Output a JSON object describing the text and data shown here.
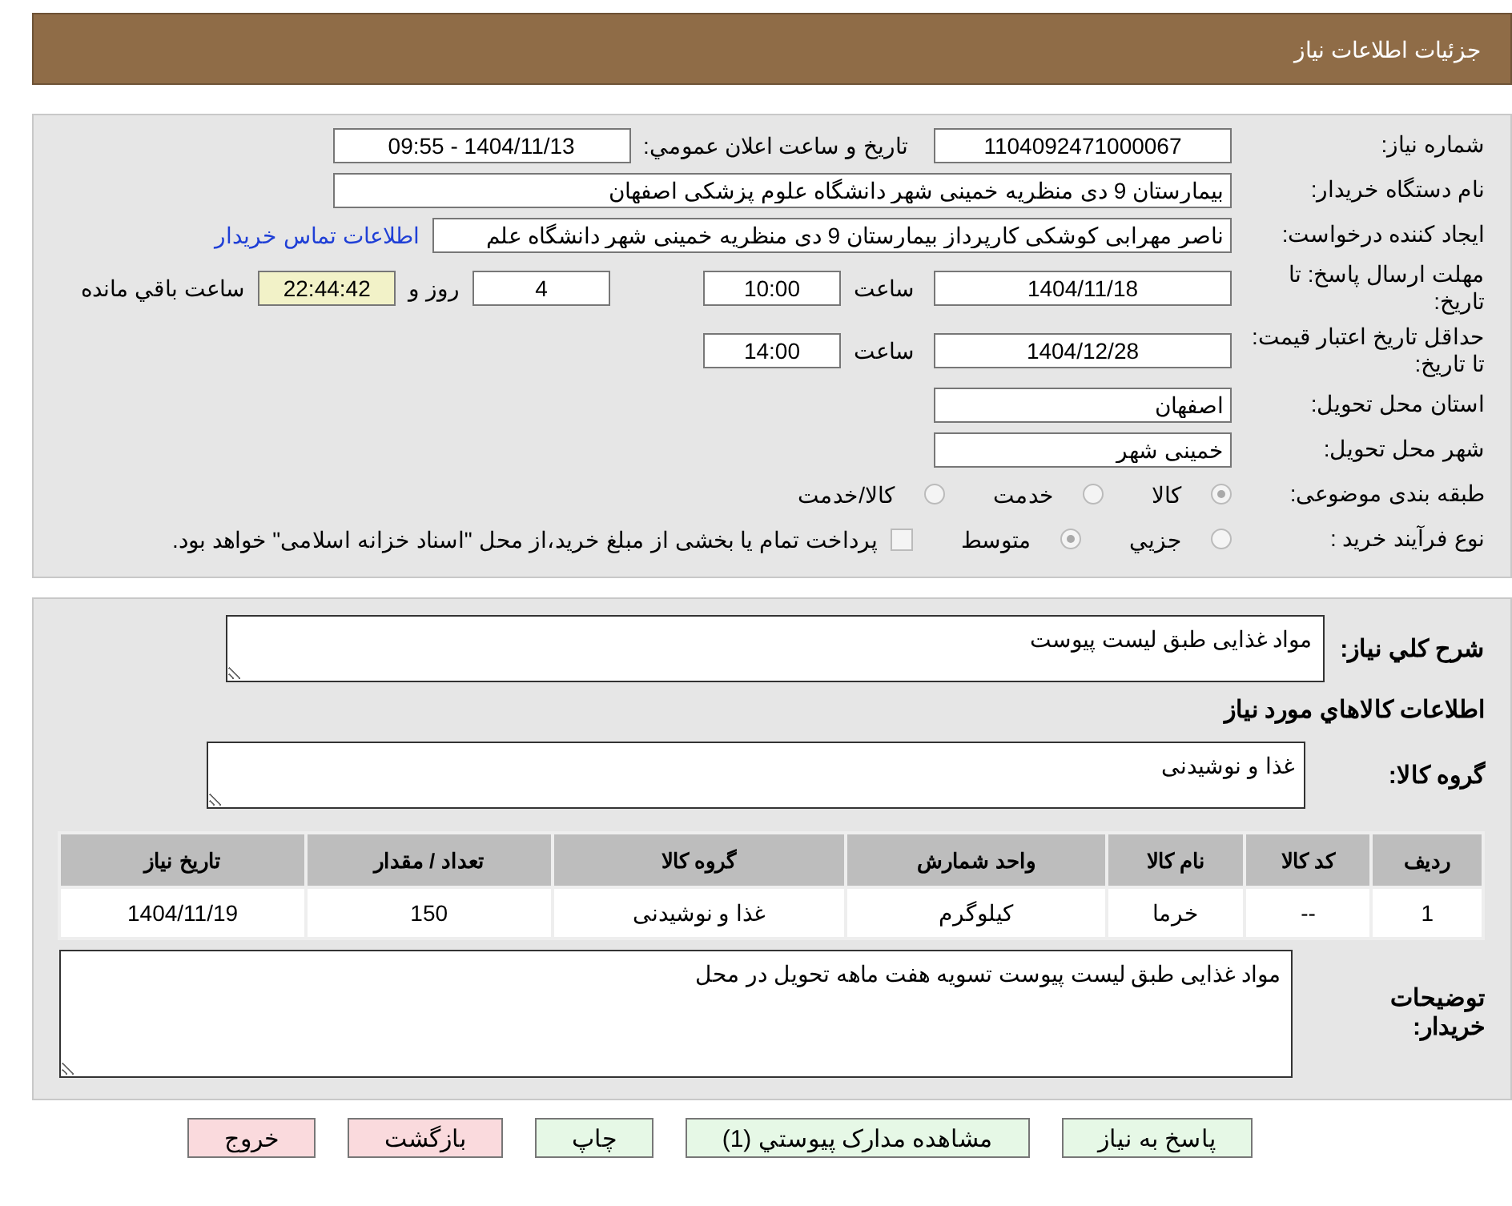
{
  "header": {
    "title": "جزئیات اطلاعات نیاز"
  },
  "details": {
    "need_number": {
      "label": "شماره نیاز:",
      "value": "1104092471000067"
    },
    "announce": {
      "label": "تاريخ و ساعت اعلان عمومي:",
      "value": "1404/11/13 - 09:55"
    },
    "buyer": {
      "label": "نام دستگاه خریدار:",
      "value": "بیمارستان 9 دی منظریه خمینی شهر دانشگاه علوم پزشکی اصفهان"
    },
    "creator": {
      "label": "ایجاد کننده درخواست:",
      "value": "ناصر مهرابی کوشکی کارپرداز بیمارستان 9 دی منظریه خمینی شهر دانشگاه علم",
      "link": "اطلاعات تماس خریدار"
    },
    "deadline": {
      "label": "مهلت ارسال پاسخ: تا تاریخ:",
      "date": "1404/11/18",
      "time_label": "ساعت",
      "time": "10:00",
      "days": "4",
      "days_label": "روز و",
      "remaining": "22:44:42",
      "remaining_label": "ساعت باقي مانده"
    },
    "validity": {
      "label": "حداقل تاریخ اعتبار قیمت: تا تاریخ:",
      "date": "1404/12/28",
      "time_label": "ساعت",
      "time": "14:00"
    },
    "province": {
      "label": "استان محل تحویل:",
      "value": "اصفهان"
    },
    "city": {
      "label": "شهر محل تحویل:",
      "value": "خمینی شهر"
    },
    "category": {
      "label": "طبقه بندی موضوعی:",
      "options": [
        {
          "label": "کالا",
          "selected": true
        },
        {
          "label": "خدمت",
          "selected": false
        },
        {
          "label": "کالا/خدمت",
          "selected": false
        }
      ]
    },
    "process": {
      "label": "نوع فرآیند خرید :",
      "options": [
        {
          "label": "جزيي",
          "selected": false
        },
        {
          "label": "متوسط",
          "selected": true
        }
      ],
      "treasury": {
        "checked": false,
        "label": "پرداخت تمام یا بخشی از مبلغ خرید،از محل \"اسناد خزانه اسلامی\" خواهد بود."
      }
    }
  },
  "summary": {
    "label": "شرح کلي نیاز:",
    "value": "مواد غذایی طبق لیست پیوست"
  },
  "goods_heading": "اطلاعات کالاهاي مورد نیاز",
  "goods_group": {
    "label": "گروه کالا:",
    "value": "غذا و نوشیدنی"
  },
  "table": {
    "columns": [
      "ردیف",
      "کد کالا",
      "نام کالا",
      "واحد شمارش",
      "گروه کالا",
      "تعداد / مقدار",
      "تاریخ نیاز"
    ],
    "rows": [
      [
        "1",
        "--",
        "خرما",
        "کیلوگرم",
        "غذا و نوشیدنی",
        "150",
        "1404/11/19"
      ]
    ]
  },
  "buyer_notes": {
    "label": "توضیحات خریدار:",
    "value": "مواد غذایی طبق لیست پیوست تسویه هفت ماهه تحویل در محل"
  },
  "buttons": [
    {
      "label": "پاسخ به نیاز",
      "kind": "primary"
    },
    {
      "label": "مشاهده مدارک پیوستي (1)",
      "kind": "primary"
    },
    {
      "label": "چاپ",
      "kind": "primary"
    },
    {
      "label": "بازگشت",
      "kind": "danger"
    },
    {
      "label": "خروج",
      "kind": "danger"
    }
  ]
}
